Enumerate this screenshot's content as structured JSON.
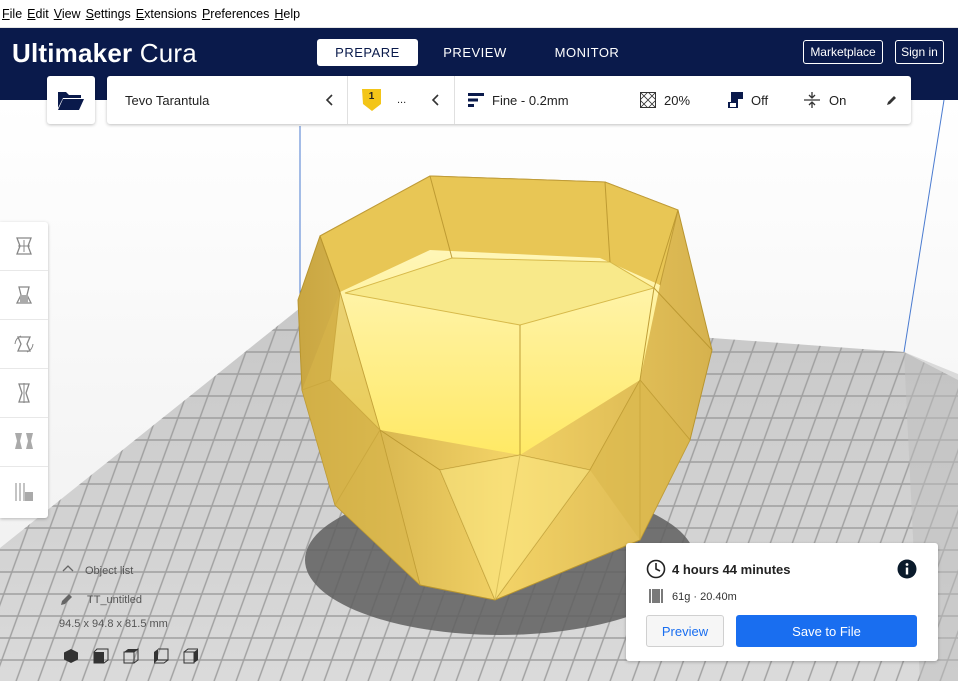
{
  "menu": [
    "File",
    "Edit",
    "View",
    "Settings",
    "Extensions",
    "Preferences",
    "Help"
  ],
  "header": {
    "logo_bold": "Ultimaker",
    "logo_light": "Cura",
    "tabs": [
      {
        "label": "PREPARE",
        "active": true
      },
      {
        "label": "PREVIEW",
        "active": false
      },
      {
        "label": "MONITOR",
        "active": false
      }
    ],
    "marketplace": "Marketplace",
    "signin": "Sign in",
    "bg_color": "#0a1a4b"
  },
  "toolbar": {
    "printer": "Tevo Tarantula",
    "extruder_number": "1",
    "extruder_more": "...",
    "profile": "Fine - 0.2mm",
    "infill": "20%",
    "support": "Off",
    "adhesion": "On"
  },
  "object": {
    "list_label": "Object list",
    "name": "TT_untitled",
    "dimensions": "94.5 x 94.8 x 81.5 mm"
  },
  "print": {
    "time": "4 hours 44 minutes",
    "material": "61g · 20.40m",
    "preview_btn": "Preview",
    "save_btn": "Save to File",
    "accent": "#196ef0"
  },
  "model_color": "#f2cf5b"
}
